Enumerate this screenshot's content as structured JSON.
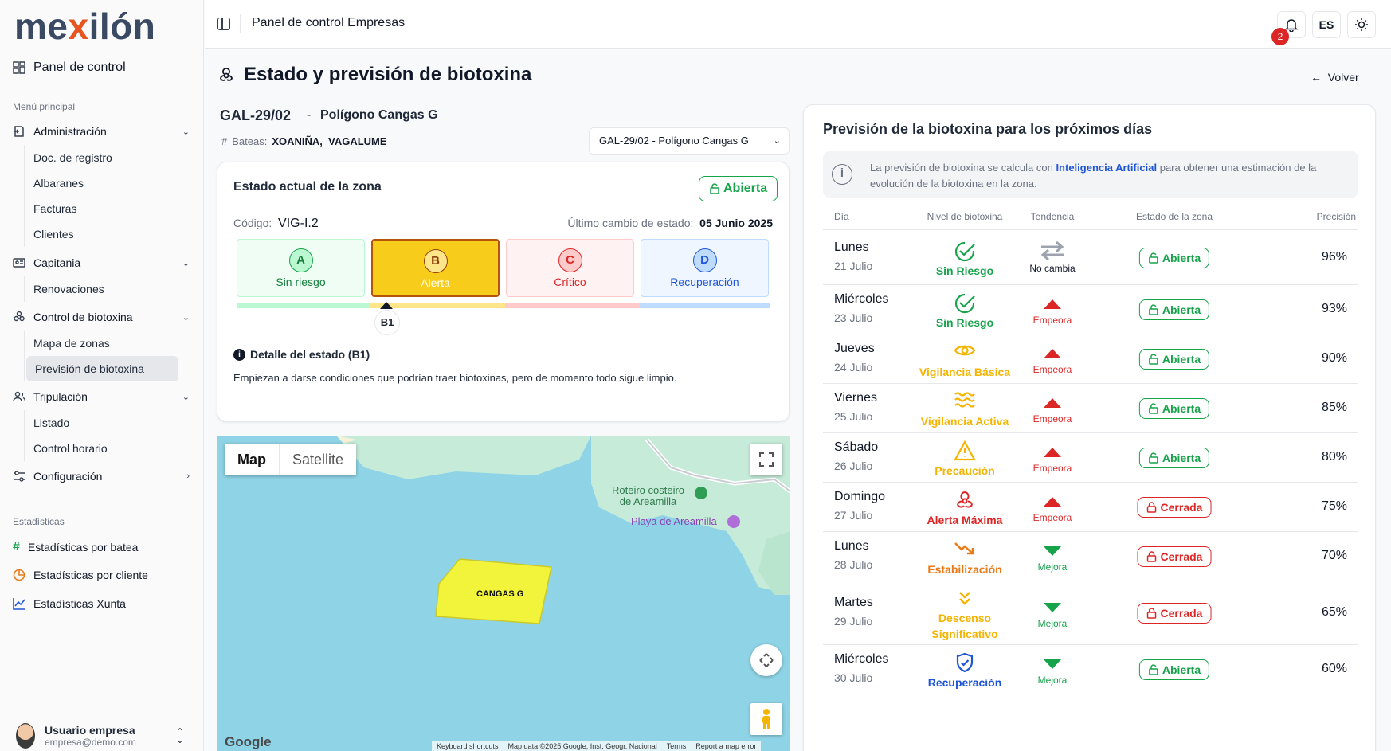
{
  "brand": {
    "logo_pre": "me",
    "logo_x": "x",
    "logo_post": "ilón"
  },
  "sidebar": {
    "dashboard": "Panel de control",
    "menu_label": "Menú principal",
    "groups": [
      {
        "label": "Administración",
        "items": [
          "Doc. de registro",
          "Albaranes",
          "Facturas",
          "Clientes"
        ]
      },
      {
        "label": "Capitania",
        "items": [
          "Renovaciones"
        ]
      },
      {
        "label": "Control de biotoxina",
        "items": [
          "Mapa de zonas",
          "Previsión de biotoxina"
        ]
      },
      {
        "label": "Tripulación",
        "items": [
          "Listado",
          "Control horario"
        ]
      },
      {
        "label": "Configuración",
        "items": []
      }
    ],
    "stats_label": "Estadísticas",
    "stats": [
      "Estadísticas por batea",
      "Estadísticas por cliente",
      "Estadísticas Xunta"
    ],
    "user": {
      "name": "Usuario empresa",
      "email": "empresa@demo.com"
    }
  },
  "header": {
    "title": "Panel de control Empresas",
    "notifications": "2",
    "lang": "ES"
  },
  "page": {
    "title": "Estado y previsión de biotoxina",
    "back": "Volver",
    "zone_code": "GAL-29/02",
    "zone_dash": "-",
    "zone_name": "Polígono Cangas G",
    "bateas_label": "Bateas:",
    "bateas": "XOANIÑA,  VAGALUME",
    "select_value": "GAL-29/02 - Polígono Cangas G"
  },
  "state": {
    "title": "Estado actual de la zona",
    "status": "Abierta",
    "code_label": "Código:",
    "code": "VIG-I.2",
    "change_label": "Último cambio de estado:",
    "change_date": "05 Junio 2025",
    "levels": [
      {
        "letter": "A",
        "label": "Sin riesgo"
      },
      {
        "letter": "B",
        "label": "Alerta"
      },
      {
        "letter": "C",
        "label": "Crítico"
      },
      {
        "letter": "D",
        "label": "Recuperación"
      }
    ],
    "marker": "B1",
    "detail_title": "Detalle del estado (B1)",
    "detail_text": "Empiezan a darse condiciones que podrían traer biotoxinas, pero de momento todo sigue limpio."
  },
  "map": {
    "tab_map": "Map",
    "tab_sat": "Satellite",
    "poi1": "Roteiro costeiro\nde Areamilla",
    "poi2": "Playa de Areamilla",
    "zone": "CANGAS G",
    "google": "Google",
    "footer": [
      "Keyboard shortcuts",
      "Map data ©2025 Google, Inst. Geogr. Nacional",
      "Terms",
      "Report a map error"
    ]
  },
  "forecast": {
    "title": "Previsión de la biotoxina para los próximos días",
    "info_pre": "La previsión de biotoxina se calcula con ",
    "info_link": "Inteligencia Artificial",
    "info_post": " para obtener una estimación de la evolución de la biotoxina en la zona.",
    "headers": [
      "Día",
      "Nivel de biotoxina",
      "Tendencia",
      "Estado de la zona",
      "Precisión"
    ],
    "rows": [
      {
        "day": "Lunes",
        "date": "21 Julio",
        "level": "Sin Riesgo",
        "icon": "check-circle-icon",
        "color": "#16a34a",
        "trend": "No cambia",
        "tcolor": "#111827",
        "ttype": "same",
        "zone": "Abierta",
        "prec": "96%"
      },
      {
        "day": "Miércoles",
        "date": "23 Julio",
        "level": "Sin Riesgo",
        "icon": "check-circle-icon",
        "color": "#16a34a",
        "trend": "Empeora",
        "tcolor": "#dc2626",
        "ttype": "up",
        "zone": "Abierta",
        "prec": "93%"
      },
      {
        "day": "Jueves",
        "date": "24 Julio",
        "level": "Vigilancia Básica",
        "icon": "eye-icon",
        "color": "#f5b400",
        "trend": "Empeora",
        "tcolor": "#dc2626",
        "ttype": "up",
        "zone": "Abierta",
        "prec": "90%"
      },
      {
        "day": "Viernes",
        "date": "25 Julio",
        "level": "Vigilancia Activa",
        "icon": "waves-icon",
        "color": "#f5b400",
        "trend": "Empeora",
        "tcolor": "#dc2626",
        "ttype": "up",
        "zone": "Abierta",
        "prec": "85%"
      },
      {
        "day": "Sábado",
        "date": "26 Julio",
        "level": "Precaución",
        "icon": "warning-icon",
        "color": "#f5b400",
        "trend": "Empeora",
        "tcolor": "#dc2626",
        "ttype": "up",
        "zone": "Abierta",
        "prec": "80%"
      },
      {
        "day": "Domingo",
        "date": "27 Julio",
        "level": "Alerta Máxima",
        "icon": "biohazard-icon",
        "color": "#dc2626",
        "trend": "Empeora",
        "tcolor": "#dc2626",
        "ttype": "up",
        "zone": "Cerrada",
        "prec": "75%"
      },
      {
        "day": "Lunes",
        "date": "28 Julio",
        "level": "Estabilización",
        "icon": "trend-down-icon",
        "color": "#ea7a17",
        "trend": "Mejora",
        "tcolor": "#16a34a",
        "ttype": "down",
        "zone": "Cerrada",
        "prec": "70%"
      },
      {
        "day": "Martes",
        "date": "29 Julio",
        "level": "Descenso Significativo",
        "icon": "double-chevron-down-icon",
        "color": "#f5b400",
        "trend": "Mejora",
        "tcolor": "#16a34a",
        "ttype": "down",
        "zone": "Cerrada",
        "prec": "65%"
      },
      {
        "day": "Miércoles",
        "date": "30 Julio",
        "level": "Recuperación",
        "icon": "shield-check-icon",
        "color": "#1e55d6",
        "trend": "Mejora",
        "tcolor": "#16a34a",
        "ttype": "down",
        "zone": "Abierta",
        "prec": "60%"
      }
    ]
  }
}
